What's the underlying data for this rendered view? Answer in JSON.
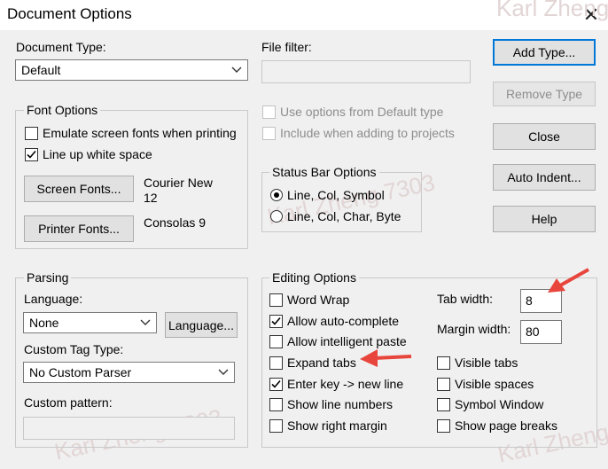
{
  "window": {
    "title": "Document Options",
    "close_glyph": "✕"
  },
  "watermark": {
    "text": "Karl Zheng 7303"
  },
  "document_type": {
    "label": "Document Type:",
    "value": "Default"
  },
  "file_filter": {
    "label": "File filter:",
    "value": ""
  },
  "file_options": {
    "use_default": "Use options from Default type",
    "include_projects": "Include when adding to projects"
  },
  "buttons": {
    "add_type": "Add Type...",
    "remove_type": "Remove Type",
    "close": "Close",
    "auto_indent": "Auto Indent...",
    "help": "Help"
  },
  "font_options": {
    "title": "Font Options",
    "emulate": {
      "label": "Emulate screen fonts when printing",
      "checked": false
    },
    "line_up": {
      "label": "Line up white space",
      "checked": true
    },
    "screen_fonts_button": "Screen Fonts...",
    "screen_font_name": "Courier New",
    "screen_font_size": "12",
    "printer_fonts_button": "Printer Fonts...",
    "printer_font": "Consolas 9"
  },
  "status_bar": {
    "title": "Status Bar Options",
    "option1": {
      "label": "Line, Col, Symbol",
      "selected": true
    },
    "option2": {
      "label": "Line, Col, Char, Byte",
      "selected": false
    }
  },
  "parsing": {
    "title": "Parsing",
    "language_label": "Language:",
    "language_value": "None",
    "language_button": "Language...",
    "custom_tag_label": "Custom Tag Type:",
    "custom_tag_value": "No Custom Parser",
    "custom_pattern_label": "Custom pattern:",
    "custom_pattern_value": ""
  },
  "editing": {
    "title": "Editing Options",
    "word_wrap": {
      "label": "Word Wrap",
      "checked": false
    },
    "auto_complete": {
      "label": "Allow auto-complete",
      "checked": true
    },
    "intelligent_paste": {
      "label": "Allow intelligent paste",
      "checked": false
    },
    "expand_tabs": {
      "label": "Expand tabs",
      "checked": false
    },
    "enter_key": {
      "label": "Enter key -> new line",
      "checked": true
    },
    "line_numbers": {
      "label": "Show line numbers",
      "checked": false
    },
    "right_margin": {
      "label": "Show right margin",
      "checked": false
    },
    "tab_width_label": "Tab width:",
    "tab_width_value": "8",
    "margin_width_label": "Margin width:",
    "margin_width_value": "80",
    "visible_tabs": {
      "label": "Visible tabs",
      "checked": false
    },
    "visible_spaces": {
      "label": "Visible spaces",
      "checked": false
    },
    "symbol_window": {
      "label": "Symbol Window",
      "checked": false
    },
    "page_breaks": {
      "label": "Show page breaks",
      "checked": false
    }
  },
  "annotations": {
    "arrow_color": "#e8453c"
  }
}
